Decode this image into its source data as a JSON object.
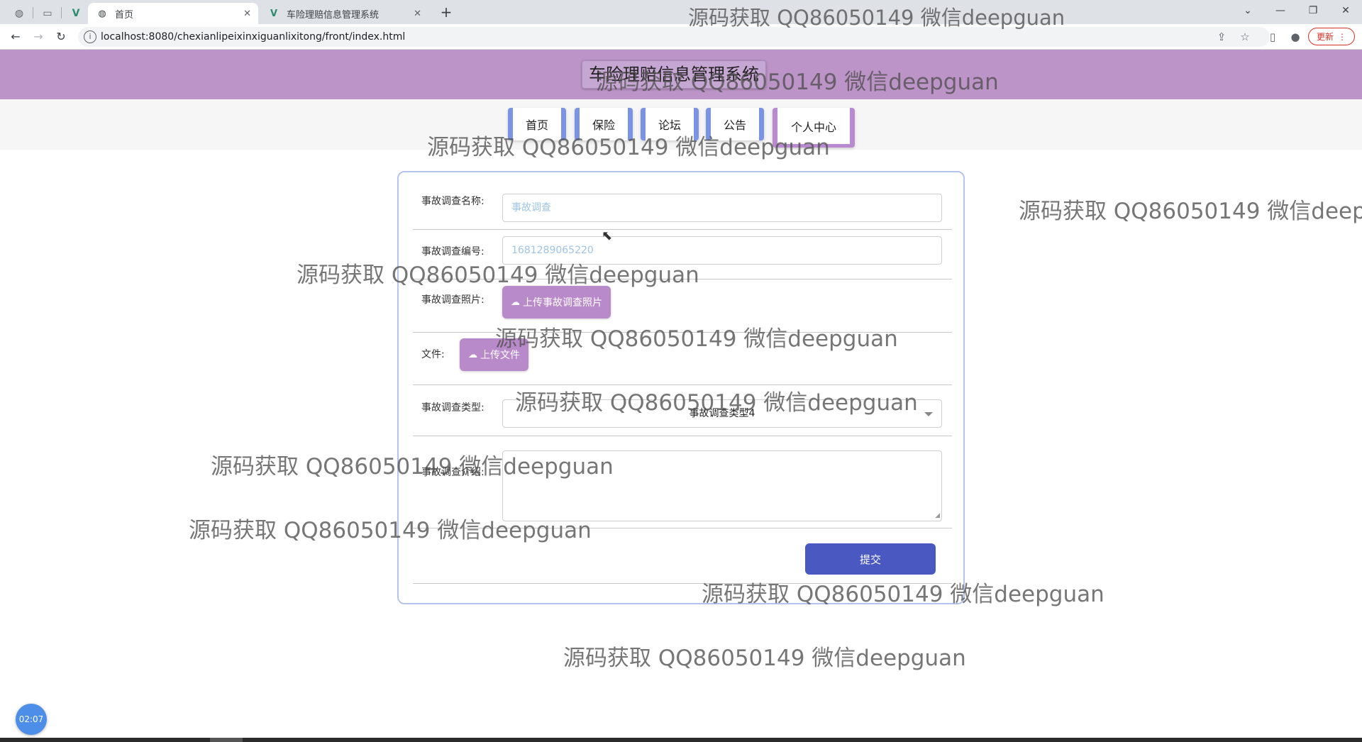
{
  "browser": {
    "tabs": [
      {
        "label": "首页",
        "active": true
      },
      {
        "label": "车险理赔信息管理系统",
        "active": false
      }
    ],
    "url": "localhost:8080/chexianlipeixinxiguanlixitong/front/index.html",
    "update_label": "更新"
  },
  "site": {
    "title": "车险理赔信息管理系统",
    "nav": [
      "首页",
      "保险",
      "论坛",
      "公告",
      "个人中心"
    ]
  },
  "form": {
    "name_label": "事故调查名称:",
    "name_placeholder": "事故调查",
    "code_label": "事故调查编号:",
    "code_value": "1681289065220",
    "photo_label": "事故调查照片:",
    "photo_button": "上传事故调查照片",
    "file_label": "文件:",
    "file_button": "上传文件",
    "type_label": "事故调查类型:",
    "type_value": "事故调查类型4",
    "intro_label": "事故调查介绍:",
    "submit_label": "提交"
  },
  "timer": "02:07",
  "watermark": "源码获取 QQ86050149 微信deepguan",
  "watermark_cut": "源码获取 QQ86050149 微信deepg",
  "colors": {
    "header_bg": "#bc94c8",
    "nav_accent_blue": "#7b93e3",
    "nav_accent_purple": "#b98ad0",
    "upload_button": "#b98ac9",
    "submit_button": "#4a58c2",
    "card_border": "#b5c4ef"
  }
}
